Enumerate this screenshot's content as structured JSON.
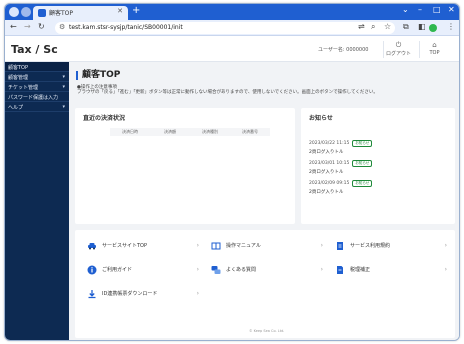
{
  "browser": {
    "tab_title": "顧客TOP",
    "url": "test.kam.stsr-sysjp/tanic/SB00001/init"
  },
  "header": {
    "logo": "Tax / Sc",
    "user": "ユーザー名: 0000000",
    "logout_label": "ログアウト",
    "top_label": "TOP"
  },
  "sidebar": {
    "items": [
      {
        "label": "顧客TOP",
        "chevron": false
      },
      {
        "label": "顧客管理",
        "chevron": true
      },
      {
        "label": "チケット管理",
        "chevron": true
      },
      {
        "label": "パスワード保護は入力",
        "chevron": false
      },
      {
        "label": "ヘルプ",
        "chevron": true
      }
    ]
  },
  "main": {
    "title": "顧客TOP",
    "notice_title": "●操作上の注意事項",
    "notice_body": "ブラウザの「戻る」「進む」「更新」ボタン等は正常に動作しない場合がありますので、使用しないでください。画面上のボタンで操作してください。"
  },
  "recent": {
    "title": "直近の決済状況",
    "columns": [
      "決済日時",
      "決済額",
      "決済種別",
      "決済番号"
    ]
  },
  "news": {
    "title": "お知らせ",
    "items": [
      {
        "date": "2023/03/22 11:15",
        "badge": "お知らせ",
        "title": "2頁ログ入りトル"
      },
      {
        "date": "2023/03/01 10:15",
        "badge": "お知らせ",
        "title": "2頁ログ入りトル"
      },
      {
        "date": "2023/02/09 09:15",
        "badge": "お知らせ",
        "title": "2頁ログ入りトル"
      }
    ]
  },
  "links": {
    "service_site": "サービスサイトTOP",
    "manual": "操作マニュアル",
    "service_terms": "サービス利用規約",
    "guide": "ご利用ガイド",
    "faq": "よくある質問",
    "contact": "税理補正",
    "download": "ID連携帳票ダウンロード"
  },
  "footer": "© Keep Sea Co. Ltd.",
  "colors": {
    "tabstrip": "#1f5fd1",
    "sidebar": "#0d2a52",
    "accent": "#1f5fd1",
    "main_bg": "#f1f3f6"
  }
}
